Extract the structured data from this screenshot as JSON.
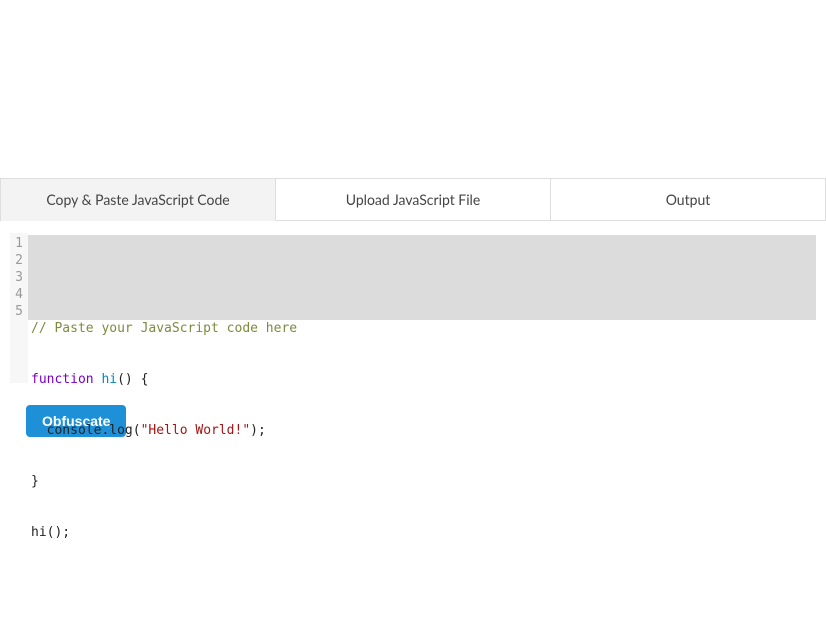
{
  "tabs": [
    {
      "label": "Copy & Paste JavaScript Code"
    },
    {
      "label": "Upload JavaScript File"
    },
    {
      "label": "Output"
    }
  ],
  "editor": {
    "lines": [
      {
        "n": "1"
      },
      {
        "n": "2"
      },
      {
        "n": "3"
      },
      {
        "n": "4"
      },
      {
        "n": "5"
      }
    ],
    "line1_comment": "// Paste your JavaScript code here",
    "line2_kw": "function",
    "line2_name": "hi",
    "line2_rest": "() {",
    "line3_pre": "  console.log(",
    "line3_str": "\"Hello World!\"",
    "line3_post": ");",
    "line4": "}",
    "line5": "hi();"
  },
  "buttons": {
    "obfuscate": "Obfuscate"
  }
}
